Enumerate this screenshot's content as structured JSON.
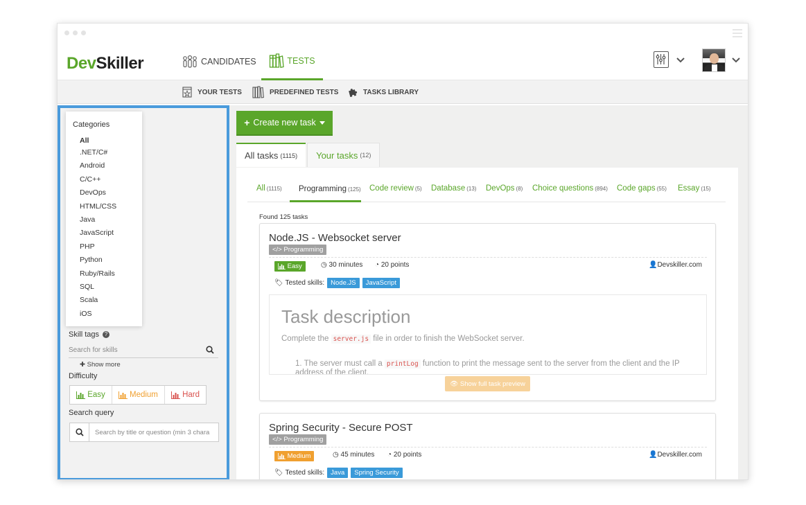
{
  "brand": {
    "dev": "Dev",
    "skiller": "Skiller"
  },
  "nav": {
    "candidates": "CANDIDATES",
    "tests": "TESTS"
  },
  "subnav": {
    "your_tests": "YOUR TESTS",
    "predefined_tests": "PREDEFINED TESTS",
    "tasks_library": "TASKS LIBRARY"
  },
  "sidebar": {
    "categories_title": "Categories",
    "categories": [
      "All",
      ".NET/C#",
      "Android",
      "C/C++",
      "DevOps",
      "HTML/CSS",
      "Java",
      "JavaScript",
      "PHP",
      "Python",
      "Ruby/Rails",
      "SQL",
      "Scala",
      "iOS"
    ],
    "skill_tags_label": "Skill tags",
    "skill_search_placeholder": "Search for skills",
    "show_more": "Show more",
    "difficulty_label": "Difficulty",
    "difficulty": {
      "easy": "Easy",
      "medium": "Medium",
      "hard": "Hard"
    },
    "search_query_label": "Search query",
    "search_query_placeholder": "Search by title or question (min 3 chara"
  },
  "main": {
    "create_button": "Create new task",
    "tabs": [
      {
        "label": "All tasks",
        "count": "(1115)"
      },
      {
        "label": "Your tasks",
        "count": "(12)"
      }
    ],
    "filters": [
      {
        "label": "All",
        "count": "(1115)"
      },
      {
        "label": "Programming",
        "count": "(125)"
      },
      {
        "label": "Code review",
        "count": "(5)"
      },
      {
        "label": "Database",
        "count": "(13)"
      },
      {
        "label": "DevOps",
        "count": "(8)"
      },
      {
        "label": "Choice questions",
        "count": "(894)"
      },
      {
        "label": "Code gaps",
        "count": "(55)"
      },
      {
        "label": "Essay",
        "count": "(15)"
      }
    ],
    "found": "Found 125 tasks",
    "tasks": [
      {
        "title": "Node.JS - Websocket server",
        "type": "Programming",
        "difficulty": "Easy",
        "duration": "30 minutes",
        "points": "20 points",
        "author": "Devskiller.com",
        "tested_label": "Tested skills:",
        "skills": [
          "Node.JS",
          "JavaScript"
        ],
        "description_title": "Task description",
        "description_pre": "Complete the",
        "description_code": "server.js",
        "description_post": "file in order to finish the WebSocket server.",
        "item_number": "1.",
        "item_pre": "The server must call a",
        "item_code": "printLog",
        "item_post": "function to print the message sent to the server from the client and the IP address of the client.",
        "preview_button": "Show full task preview"
      },
      {
        "title": "Spring Security - Secure POST",
        "type": "Programming",
        "difficulty": "Medium",
        "duration": "45 minutes",
        "points": "20 points",
        "author": "Devskiller.com",
        "tested_label": "Tested skills:",
        "skills": [
          "Java",
          "Spring Security"
        ]
      }
    ]
  },
  "colors": {
    "brand_green": "#5aa62a",
    "highlight_blue": "#4a9bdc",
    "skill_blue": "#3a9ad9",
    "medium_orange": "#f0a030",
    "hard_red": "#d9534f"
  }
}
